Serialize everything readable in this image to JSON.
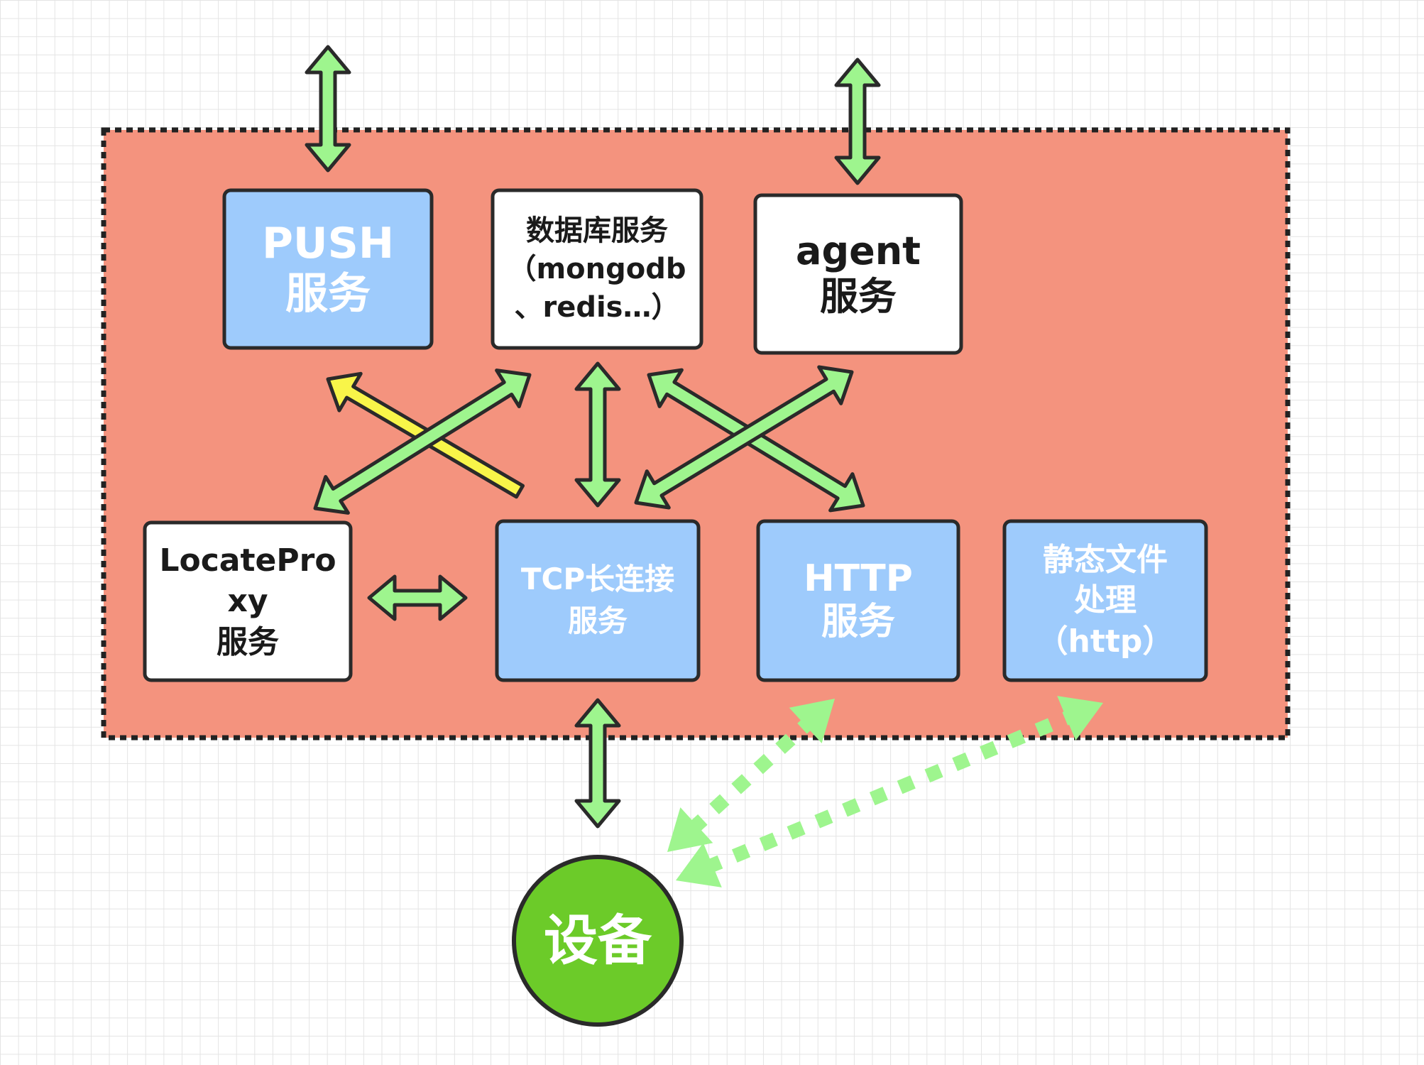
{
  "nodes": {
    "push": {
      "lines": [
        "PUSH",
        "服务"
      ]
    },
    "database": {
      "lines": [
        "数据库服务",
        "（mongodb",
        "、redis…）"
      ]
    },
    "agent": {
      "lines": [
        "agent",
        "服务"
      ]
    },
    "locate_proxy": {
      "lines": [
        "LocatePro",
        "xy",
        "服务"
      ]
    },
    "tcp": {
      "lines": [
        "TCP长连接",
        "服务"
      ]
    },
    "http": {
      "lines": [
        "HTTP",
        "服务"
      ]
    },
    "static_files": {
      "lines": [
        "静态文件",
        "处理",
        "（http）"
      ]
    },
    "device": {
      "lines": [
        "设备"
      ]
    }
  },
  "colors": {
    "container_fill": "#f4937e",
    "container_border": "#222222",
    "service_blue": "#9ecbfc",
    "service_white": "#ffffff",
    "device_green": "#6ccb29",
    "arrow_green": "#9ef58e",
    "arrow_yellow": "#f8f549",
    "outline": "#2a2a2a"
  }
}
